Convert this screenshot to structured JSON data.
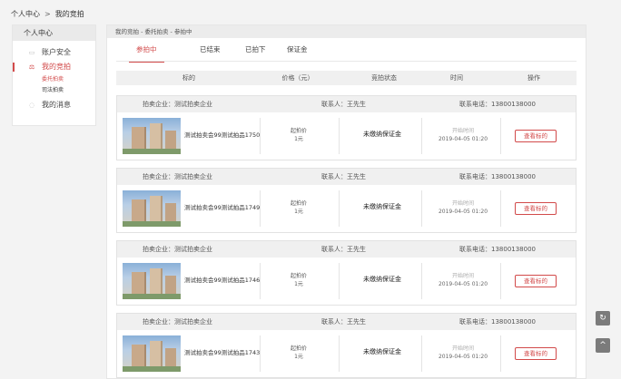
{
  "breadcrumb": {
    "home": "个人中心",
    "separator": ">",
    "current": "我的竞拍"
  },
  "sidebar": {
    "title": "个人中心",
    "items": [
      {
        "label": "账户安全",
        "icon": "card-icon"
      },
      {
        "label": "我的竞拍",
        "icon": "auction-icon"
      },
      {
        "label": "我的消息",
        "icon": "message-icon"
      }
    ],
    "sub_items": [
      {
        "label": "委托拍卖"
      },
      {
        "label": "司法拍卖"
      }
    ]
  },
  "main": {
    "breadcrumb": "我的竞拍 - 委托拍卖 - 参拍中",
    "tabs": [
      "参拍中",
      "已结束",
      "已拍下",
      "保证金"
    ],
    "columns": [
      "标的",
      "价格（元）",
      "竞拍状态",
      "时间",
      "操作"
    ]
  },
  "cards": [
    {
      "company": "拍卖企业：测试拍卖企业",
      "contact": "联系人：王先生",
      "phone": "联系电话：13800138000",
      "item": "测试拍卖会99测试拍品1750",
      "price_label": "起拍价",
      "price": "1元",
      "status": "未缴纳保证金",
      "time_label": "开始时间",
      "time": "2019-04-05 01:20",
      "action": "查看标的"
    },
    {
      "company": "拍卖企业：测试拍卖企业",
      "contact": "联系人：王先生",
      "phone": "联系电话：13800138000",
      "item": "测试拍卖会99测试拍品1749",
      "price_label": "起拍价",
      "price": "1元",
      "status": "未缴纳保证金",
      "time_label": "开始时间",
      "time": "2019-04-05 01:20",
      "action": "查看标的"
    },
    {
      "company": "拍卖企业：测试拍卖企业",
      "contact": "联系人：王先生",
      "phone": "联系电话：13800138000",
      "item": "测试拍卖会99测试拍品1746",
      "price_label": "起拍价",
      "price": "1元",
      "status": "未缴纳保证金",
      "time_label": "开始时间",
      "time": "2019-04-05 01:20",
      "action": "查看标的"
    },
    {
      "company": "拍卖企业：测试拍卖企业",
      "contact": "联系人：王先生",
      "phone": "联系电话：13800138000",
      "item": "测试拍卖会99测试拍品1743",
      "price_label": "起拍价",
      "price": "1元",
      "status": "未缴纳保证金",
      "time_label": "开始时间",
      "time": "2019-04-05 01:20",
      "action": "查看标的"
    }
  ],
  "float_buttons": {
    "refresh_icon": "↻",
    "top_icon": "^"
  },
  "colors": {
    "accent": "#d24a4a",
    "header_bg": "#f0f0f0",
    "page_bg": "#f3f3f3"
  }
}
